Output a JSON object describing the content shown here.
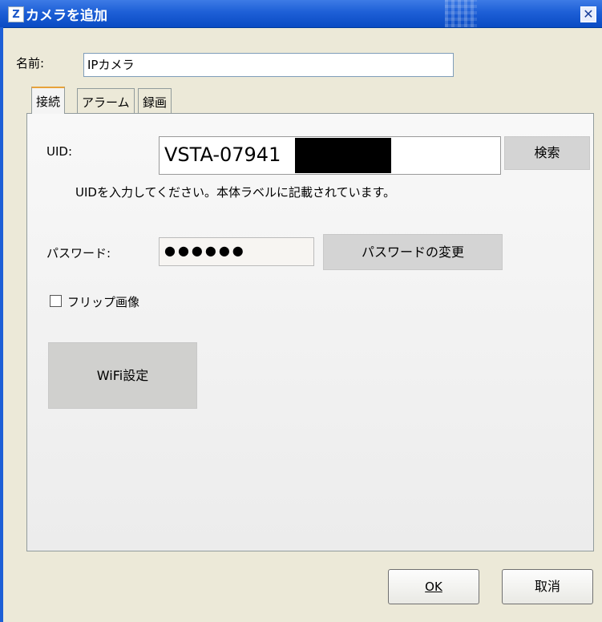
{
  "window": {
    "title": "カメラを追加",
    "icon_glyph": "Z",
    "close_glyph": "✕"
  },
  "name": {
    "label": "名前:",
    "value": "IPカメラ"
  },
  "tabs": [
    {
      "label": "接続",
      "active": true
    },
    {
      "label": "アラーム",
      "active": false
    },
    {
      "label": "録画",
      "active": false
    }
  ],
  "connection": {
    "uid_label": "UID:",
    "uid_value": "VSTA-07941",
    "search_label": "検索",
    "uid_hint": "UIDを入力してください。本体ラベルに記載されています。",
    "password_label": "パスワード:",
    "password_value": "●●●●●●",
    "change_password_label": "パスワードの変更",
    "flip_label": "フリップ画像",
    "flip_checked": false,
    "wifi_label": "WiFi設定"
  },
  "footer": {
    "ok_label": "OK",
    "cancel_label": "取消"
  },
  "colors": {
    "titlebar": "#1d5fd6",
    "dialog_bg": "#ece9d8",
    "button_gray": "#d4d4d4"
  }
}
